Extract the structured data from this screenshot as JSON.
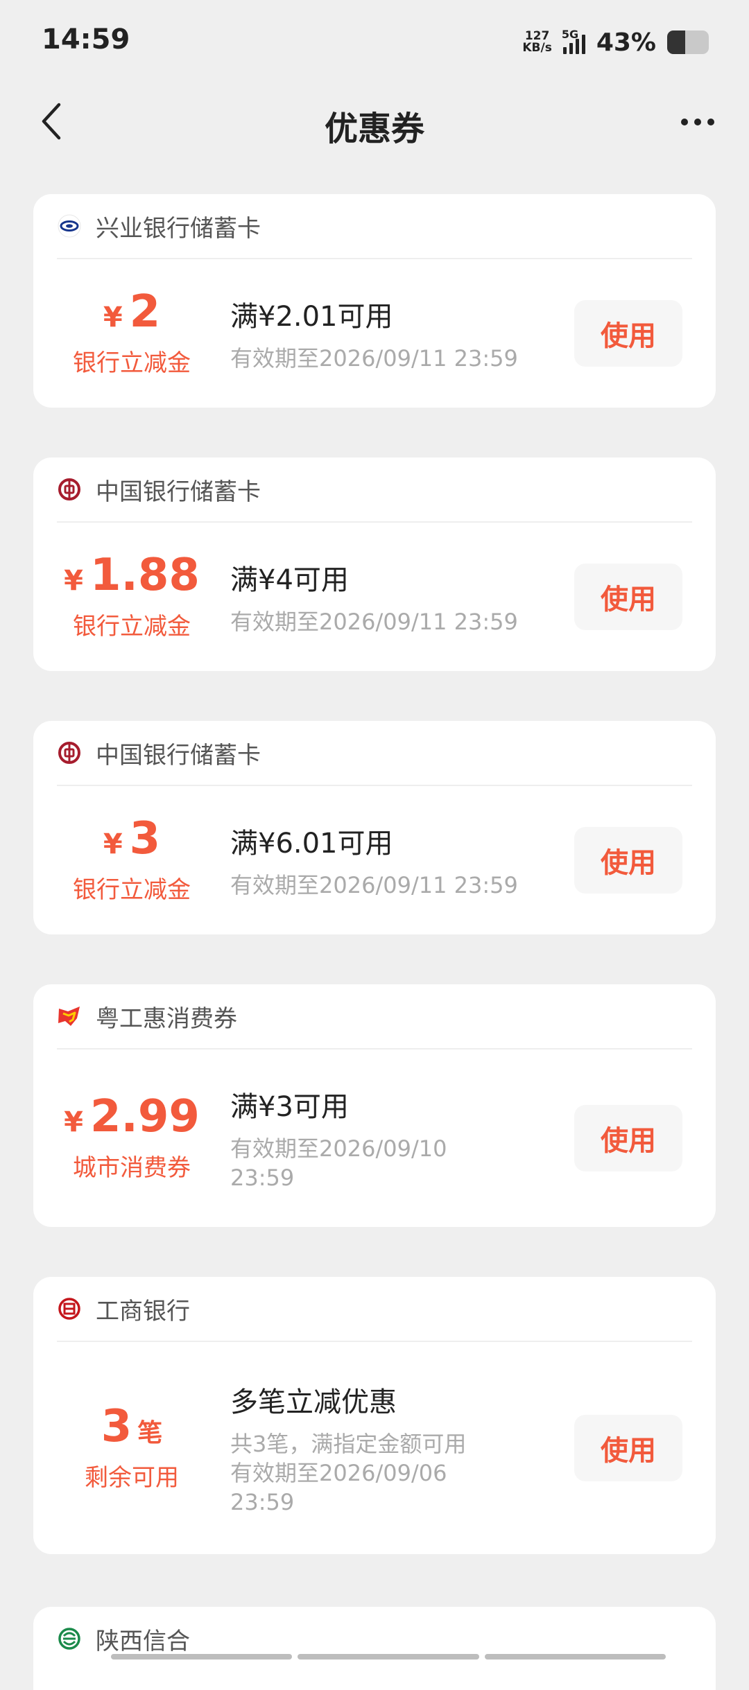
{
  "status_bar": {
    "time": "14:59",
    "net_speed_value": "127",
    "net_speed_unit": "KB/s",
    "network": "5G",
    "battery_percent": "43%",
    "battery_level": 0.43
  },
  "header": {
    "title": "优惠券",
    "back_icon": "chevron-left-icon",
    "more_icon": "more-horizontal-icon"
  },
  "coupons": [
    {
      "bank": "兴业银行储蓄卡",
      "logo": "cib-logo-icon",
      "currency": "¥",
      "amount": "2",
      "unit": "",
      "type_label": "银行立减金",
      "condition": "满¥2.01可用",
      "detail": "",
      "validity": "有效期至2026/09/11 23:59",
      "button": "使用"
    },
    {
      "bank": "中国银行储蓄卡",
      "logo": "boc-logo-icon",
      "currency": "¥",
      "amount": "1.88",
      "unit": "",
      "type_label": "银行立减金",
      "condition": "满¥4可用",
      "detail": "",
      "validity": "有效期至2026/09/11 23:59",
      "button": "使用"
    },
    {
      "bank": "中国银行储蓄卡",
      "logo": "boc-logo-icon",
      "currency": "¥",
      "amount": "3",
      "unit": "",
      "type_label": "银行立减金",
      "condition": "满¥6.01可用",
      "detail": "",
      "validity": "有效期至2026/09/11 23:59",
      "button": "使用"
    },
    {
      "bank": "粤工惠消费券",
      "logo": "yuegonghui-logo-icon",
      "currency": "¥",
      "amount": "2.99",
      "unit": "",
      "type_label": "城市消费券",
      "condition": "满¥3可用",
      "detail": "",
      "validity": "有效期至2026/09/10 23:59",
      "button": "使用"
    },
    {
      "bank": "工商银行",
      "logo": "icbc-logo-icon",
      "currency": "",
      "amount": "3",
      "unit": "笔",
      "type_label": "剩余可用",
      "condition": "多笔立减优惠",
      "detail": "共3笔，满指定金额可用",
      "validity": "有效期至2026/09/06 23:59",
      "button": "使用"
    }
  ],
  "partial_card": {
    "bank": "陕西信合",
    "logo": "shaanxi-xinhe-logo-icon"
  },
  "colors": {
    "accent": "#f25a3c",
    "background": "#efefef",
    "card": "#ffffff"
  }
}
